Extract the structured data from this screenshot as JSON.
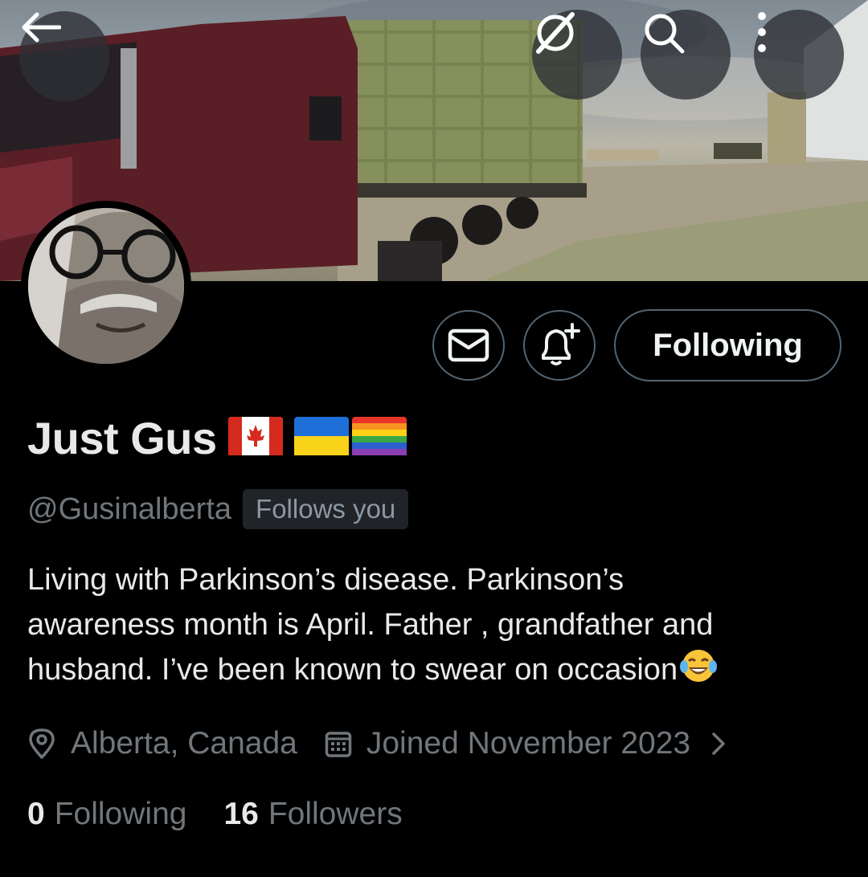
{
  "header": {
    "back_icon": "arrow-left-icon",
    "grok_icon": "grok-icon",
    "search_icon": "search-icon",
    "more_icon": "more-vertical-icon"
  },
  "profile": {
    "display_name": "Just Gus",
    "name_emojis": [
      "flag-canada",
      "flag-ukraine",
      "flag-rainbow"
    ],
    "handle": "@Gusinalberta",
    "follows_you_label": "Follows you",
    "bio_lines": [
      "Living with Parkinson’s disease. Parkinson’s",
      "awareness month is April. Father , grandfather and",
      "husband. I’ve been known to swear on occasion"
    ],
    "bio_emoji": "face-with-tears-of-joy",
    "location": "Alberta, Canada",
    "joined": "Joined November 2023",
    "following_count": "0",
    "following_label": "Following",
    "followers_count": "16",
    "followers_label": "Followers"
  },
  "actions": {
    "message_icon": "envelope-icon",
    "notify_icon": "bell-plus-icon",
    "follow_button_label": "Following"
  },
  "colors": {
    "background": "#000000",
    "primary_text": "#e7e9ea",
    "secondary_text": "#71767b",
    "button_border": "#536471",
    "badge_bg": "#202327"
  }
}
